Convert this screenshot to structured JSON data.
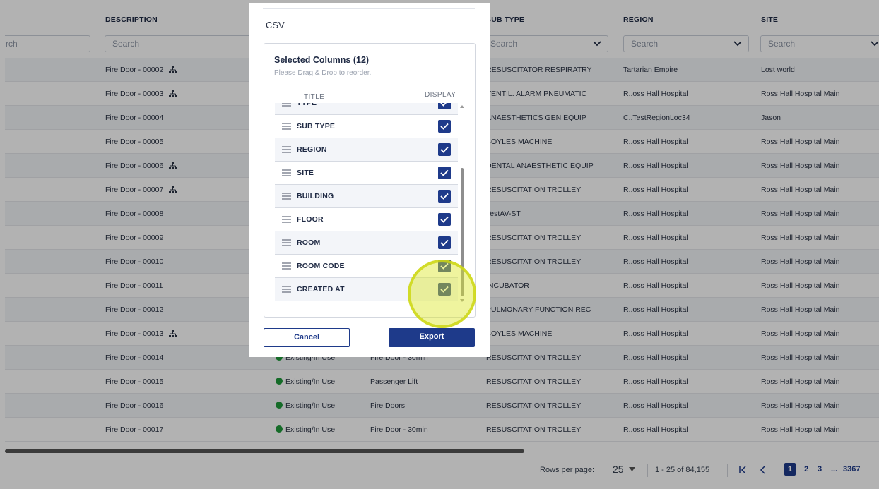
{
  "table": {
    "columns": [
      {
        "label": "DESCRIPTION"
      },
      {
        "label": "SUB TYPE"
      },
      {
        "label": "REGION"
      },
      {
        "label": "SITE"
      }
    ],
    "filters": {
      "col0": "rch",
      "description": "Search",
      "subtype": "Search",
      "region": "Search",
      "site": "Search"
    },
    "rows": [
      {
        "description": "Fire Door - 00002",
        "tree": true,
        "status": "",
        "type": "",
        "subtype": "RESUSCITATOR RESPIRATRY",
        "region": "Tartarian Empire",
        "site": "Lost world"
      },
      {
        "description": "Fire Door - 00003",
        "tree": true,
        "status": "",
        "type": "",
        "subtype": "VENTIL. ALARM PNEUMATIC",
        "region": "R..oss Hall Hospital",
        "site": "Ross Hall Hospital Main"
      },
      {
        "description": "Fire Door - 00004",
        "tree": false,
        "status": "",
        "type": "",
        "subtype": "ANAESTHETICS GEN EQUIP",
        "region": "C..TestRegionLoc34",
        "site": "Jason"
      },
      {
        "description": "Fire Door - 00005",
        "tree": false,
        "status": "",
        "type": "",
        "subtype": "BOYLES MACHINE",
        "region": "R..oss Hall Hospital",
        "site": "Ross Hall Hospital Main"
      },
      {
        "description": "Fire Door - 00006",
        "tree": true,
        "status": "",
        "type": "",
        "subtype": "DENTAL ANAESTHETIC EQUIP",
        "region": "R..oss Hall Hospital",
        "site": "Ross Hall Hospital Main"
      },
      {
        "description": "Fire Door - 00007",
        "tree": true,
        "status": "",
        "type": "",
        "subtype": "RESUSCITATION TROLLEY",
        "region": "R..oss Hall Hospital",
        "site": "Ross Hall Hospital Main"
      },
      {
        "description": "Fire Door - 00008",
        "tree": false,
        "status": "",
        "type": "",
        "subtype": "TestAV-ST",
        "region": "R..oss Hall Hospital",
        "site": "Ross Hall Hospital Main"
      },
      {
        "description": "Fire Door - 00009",
        "tree": false,
        "status": "",
        "type": "",
        "subtype": "RESUSCITATION TROLLEY",
        "region": "R..oss Hall Hospital",
        "site": "Ross Hall Hospital Main"
      },
      {
        "description": "Fire Door - 00010",
        "tree": false,
        "status": "",
        "type": "",
        "subtype": "RESUSCITATION TROLLEY",
        "region": "R..oss Hall Hospital",
        "site": "Ross Hall Hospital Main"
      },
      {
        "description": "Fire Door - 00011",
        "tree": false,
        "status": "",
        "type": "",
        "subtype": "INCUBATOR",
        "region": "R..oss Hall Hospital",
        "site": "Ross Hall Hospital Main"
      },
      {
        "description": "Fire Door - 00012",
        "tree": false,
        "status": "",
        "type": "",
        "subtype": "PULMONARY FUNCTION REC",
        "region": "R..oss Hall Hospital",
        "site": "Ross Hall Hospital Main"
      },
      {
        "description": "Fire Door - 00013",
        "tree": true,
        "status": "",
        "type": "",
        "subtype": "BOYLES MACHINE",
        "region": "R..oss Hall Hospital",
        "site": "Ross Hall Hospital Main"
      },
      {
        "description": "Fire Door - 00014",
        "tree": false,
        "status": "Existing/In Use",
        "type": "Fire Door - 30min",
        "subtype": "RESUSCITATION TROLLEY",
        "region": "R..oss Hall Hospital",
        "site": "Ross Hall Hospital Main"
      },
      {
        "description": "Fire Door - 00015",
        "tree": false,
        "status": "Existing/In Use",
        "type": "Passenger Lift",
        "subtype": "RESUSCITATION TROLLEY",
        "region": "R..oss Hall Hospital",
        "site": "Ross Hall Hospital Main"
      },
      {
        "description": "Fire Door - 00016",
        "tree": false,
        "status": "Existing/In Use",
        "type": "Fire Doors",
        "subtype": "RESUSCITATION TROLLEY",
        "region": "R..oss Hall Hospital",
        "site": "Ross Hall Hospital Main"
      },
      {
        "description": "Fire Door - 00017",
        "tree": false,
        "status": "Existing/In Use",
        "type": "Fire Door - 30min",
        "subtype": "RESUSCITATION TROLLEY",
        "region": "R..oss Hall Hospital",
        "site": "Ross Hall Hospital Main"
      }
    ],
    "status_color": "#1f9a3a"
  },
  "pagination": {
    "rows_per_page_label": "Rows per page:",
    "rows_per_page_value": "25",
    "range": "1 - 25 of 84,155",
    "first_icon": "first-page-icon",
    "prev_icon": "prev-page-icon",
    "pages": [
      "1",
      "2",
      "3"
    ],
    "ellipsis": "...",
    "last_page": "3367",
    "current_page": "1"
  },
  "modal": {
    "format": "CSV",
    "heading": "Selected Columns (12)",
    "hint": "Please Drag & Drop to reorder.",
    "title_col": "TITLE",
    "display_col": "DISPLAY",
    "columns": [
      {
        "label": "TYPE",
        "checked": true
      },
      {
        "label": "SUB TYPE",
        "checked": true
      },
      {
        "label": "REGION",
        "checked": true
      },
      {
        "label": "SITE",
        "checked": true
      },
      {
        "label": "BUILDING",
        "checked": true
      },
      {
        "label": "FLOOR",
        "checked": true
      },
      {
        "label": "ROOM",
        "checked": true
      },
      {
        "label": "ROOM CODE",
        "checked": true
      },
      {
        "label": "CREATED AT",
        "checked": true
      }
    ],
    "cancel_label": "Cancel",
    "export_label": "Export",
    "accent": "#1e3a8a"
  }
}
